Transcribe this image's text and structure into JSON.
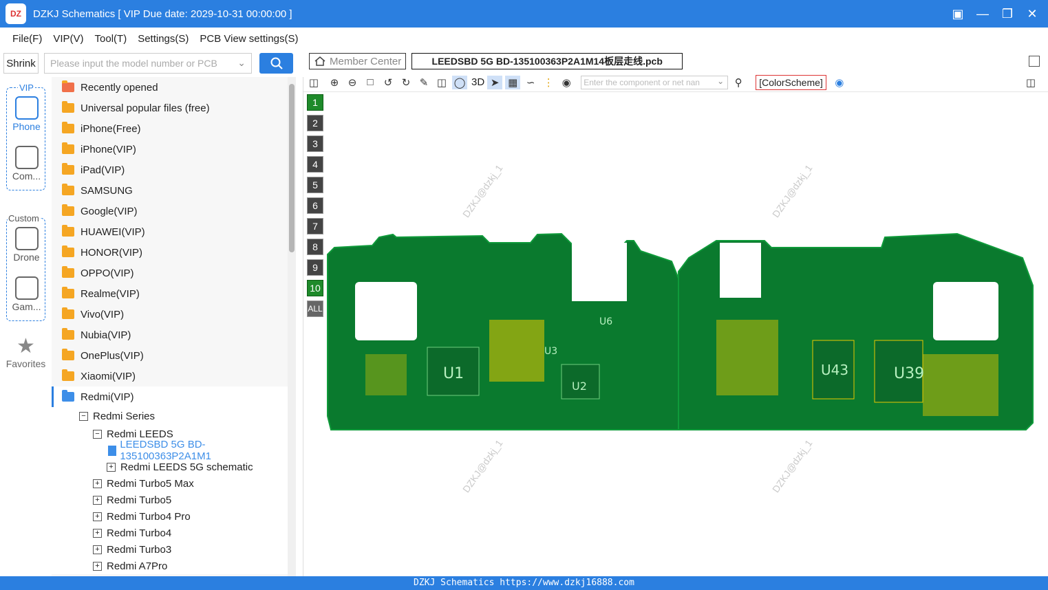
{
  "window": {
    "title": "DZKJ Schematics [ VIP Due date: 2029-10-31 00:00:00 ]",
    "logo_text": "DZ"
  },
  "menu": [
    {
      "label": "File(F)"
    },
    {
      "label": "VIP(V)"
    },
    {
      "label": "Tool(T)"
    },
    {
      "label": "Settings(S)"
    },
    {
      "label": "PCB View settings(S)"
    }
  ],
  "left_top": {
    "shrink_label": "Shrink",
    "search_placeholder": "Please input the model number or PCB"
  },
  "sidebar": {
    "vip_label": "VIP",
    "custom_label": "Custom",
    "items": [
      {
        "label": "Phone"
      },
      {
        "label": "Com..."
      },
      {
        "label": "Drone"
      },
      {
        "label": "Gam..."
      }
    ],
    "favorites_label": "Favorites"
  },
  "tree": {
    "folders": [
      {
        "label": "Recently opened"
      },
      {
        "label": "Universal popular files (free)"
      },
      {
        "label": "iPhone(Free)"
      },
      {
        "label": "iPhone(VIP)"
      },
      {
        "label": "iPad(VIP)"
      },
      {
        "label": "SAMSUNG"
      },
      {
        "label": "Google(VIP)"
      },
      {
        "label": "HUAWEI(VIP)"
      },
      {
        "label": "HONOR(VIP)"
      },
      {
        "label": "OPPO(VIP)"
      },
      {
        "label": "Realme(VIP)"
      },
      {
        "label": "Vivo(VIP)"
      },
      {
        "label": "Nubia(VIP)"
      },
      {
        "label": "OnePlus(VIP)"
      },
      {
        "label": "Xiaomi(VIP)"
      },
      {
        "label": "Redmi(VIP)"
      }
    ],
    "sub": {
      "redmi_series": "Redmi Series",
      "redmi_leeds": "Redmi LEEDS",
      "pcb_file": "LEEDSBD 5G BD-135100363P2A1M1",
      "schematic": "Redmi LEEDS 5G schematic",
      "models": [
        {
          "label": "Redmi Turbo5 Max"
        },
        {
          "label": "Redmi Turbo5"
        },
        {
          "label": "Redmi Turbo4 Pro"
        },
        {
          "label": "Redmi Turbo4"
        },
        {
          "label": "Redmi Turbo3"
        },
        {
          "label": "Redmi A7Pro"
        }
      ]
    }
  },
  "tabs": {
    "member_center": "Member Center",
    "file_tab": "LEEDSBD 5G BD-135100363P2A1M14板层走线.pcb"
  },
  "toolbar": {
    "three_d": "3D",
    "component_placeholder": "Enter the component or net nan",
    "colorscheme": "[ColorScheme]"
  },
  "layers": [
    {
      "label": "1"
    },
    {
      "label": "2"
    },
    {
      "label": "3"
    },
    {
      "label": "4"
    },
    {
      "label": "5"
    },
    {
      "label": "6"
    },
    {
      "label": "7"
    },
    {
      "label": "8"
    },
    {
      "label": "9"
    },
    {
      "label": "10"
    },
    {
      "label": "ALL"
    }
  ],
  "watermark": "DZKJ@dzkj_1",
  "board_labels": {
    "u1": "U1",
    "u2": "U2",
    "u3": "U3",
    "u6": "U6",
    "u39": "U39",
    "u43": "U43"
  },
  "status": "DZKJ Schematics https://www.dzkj16888.com"
}
